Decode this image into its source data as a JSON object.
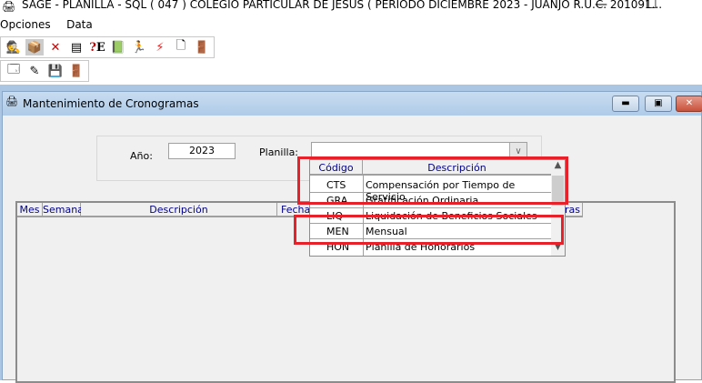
{
  "app": {
    "title": "SAGE - PLANILLA - SQL  ( 047 ) COLEGIO PARTICULAR DE JESUS ( PERIODO DICIEMBRE 2023 - JUANJO  R.U.C. 201091...",
    "minimize": "—",
    "maximize": "☐"
  },
  "menu": [
    "Opciones",
    "Data"
  ],
  "toolbar1": [
    "user-icon",
    "box-icon",
    "delete-icon",
    "list-icon",
    "help-icon",
    "book-icon",
    "run-icon",
    "flash-icon",
    "page-icon",
    "exit-icon"
  ],
  "toolbar2": [
    "new-icon",
    "edit-icon",
    "save-icon",
    "exit-icon"
  ],
  "child": {
    "title": "Mantenimiento de Cronogramas"
  },
  "form": {
    "year_label": "Año:",
    "year_value": "2023",
    "planilla_label": "Planilla:",
    "planilla_value": ""
  },
  "grid": {
    "headers": [
      "Mes",
      "Semana",
      "Descripción",
      "Fecha",
      "Horas"
    ]
  },
  "dropdown": {
    "headers": [
      "Código",
      "Descripción"
    ],
    "rows": [
      [
        "CTS",
        "Compensación por Tiempo de Servicio"
      ],
      [
        "GRA",
        "Gratificación Ordinaria"
      ],
      [
        "LIQ",
        "Liquidación de Beneficios Sociales"
      ],
      [
        "MEN",
        "Mensual"
      ],
      [
        "HON",
        "Planilla de Honorarios"
      ]
    ]
  },
  "colors": {
    "highlight": "#e8202a",
    "header_text": "#00008b"
  }
}
